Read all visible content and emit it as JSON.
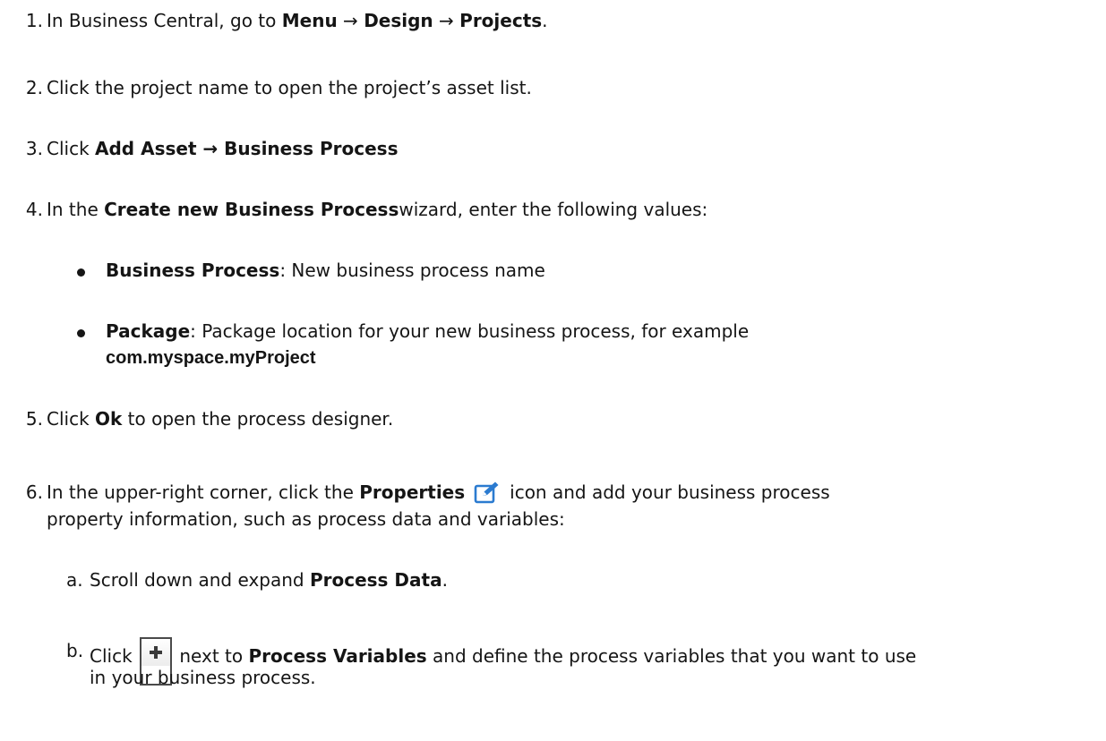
{
  "steps": [
    {
      "num": "1.",
      "pre": "In Business Central, go to ",
      "b1": "Menu",
      "arrow1": " → ",
      "b2": "Design",
      "arrow2": " → ",
      "b3": "Projects",
      "post": "."
    },
    {
      "num": "2.",
      "text": "Click the project name to open the project’s asset list."
    },
    {
      "num": "3.",
      "pre": "Click ",
      "b1": "Add Asset → Business Process"
    },
    {
      "num": "4.",
      "pre": "In the ",
      "b1": "Create new Business Process",
      "post": "wizard, enter the following values:",
      "bullets": [
        {
          "label": "Business Process",
          "text": ": New business process name"
        },
        {
          "label": "Package",
          "text": ": Package location for your new business process, for example",
          "code": "com.myspace.myProject"
        }
      ]
    },
    {
      "num": "5.",
      "pre": "Click ",
      "b1": "Ok",
      "post": " to open the process designer."
    },
    {
      "num": "6.",
      "pre": "In the upper-right corner, click the ",
      "b1": "Properties",
      "icon": "edit-icon",
      "post1": "icon and add your business process",
      "post2": "property information, such as process data and variables:",
      "substeps": [
        {
          "letter": "a.",
          "pre": "Scroll down and expand ",
          "b1": "Process Data",
          "post": "."
        },
        {
          "letter": "b.",
          "pre": "Click ",
          "icon": "plus-icon",
          "mid": " next to ",
          "b1": "Process Variables",
          "post1": " and define the process variables that you want to use",
          "post2": "in your business process."
        }
      ]
    }
  ],
  "colors": {
    "text": "#151515",
    "icon_blue": "#2b7bd0"
  }
}
